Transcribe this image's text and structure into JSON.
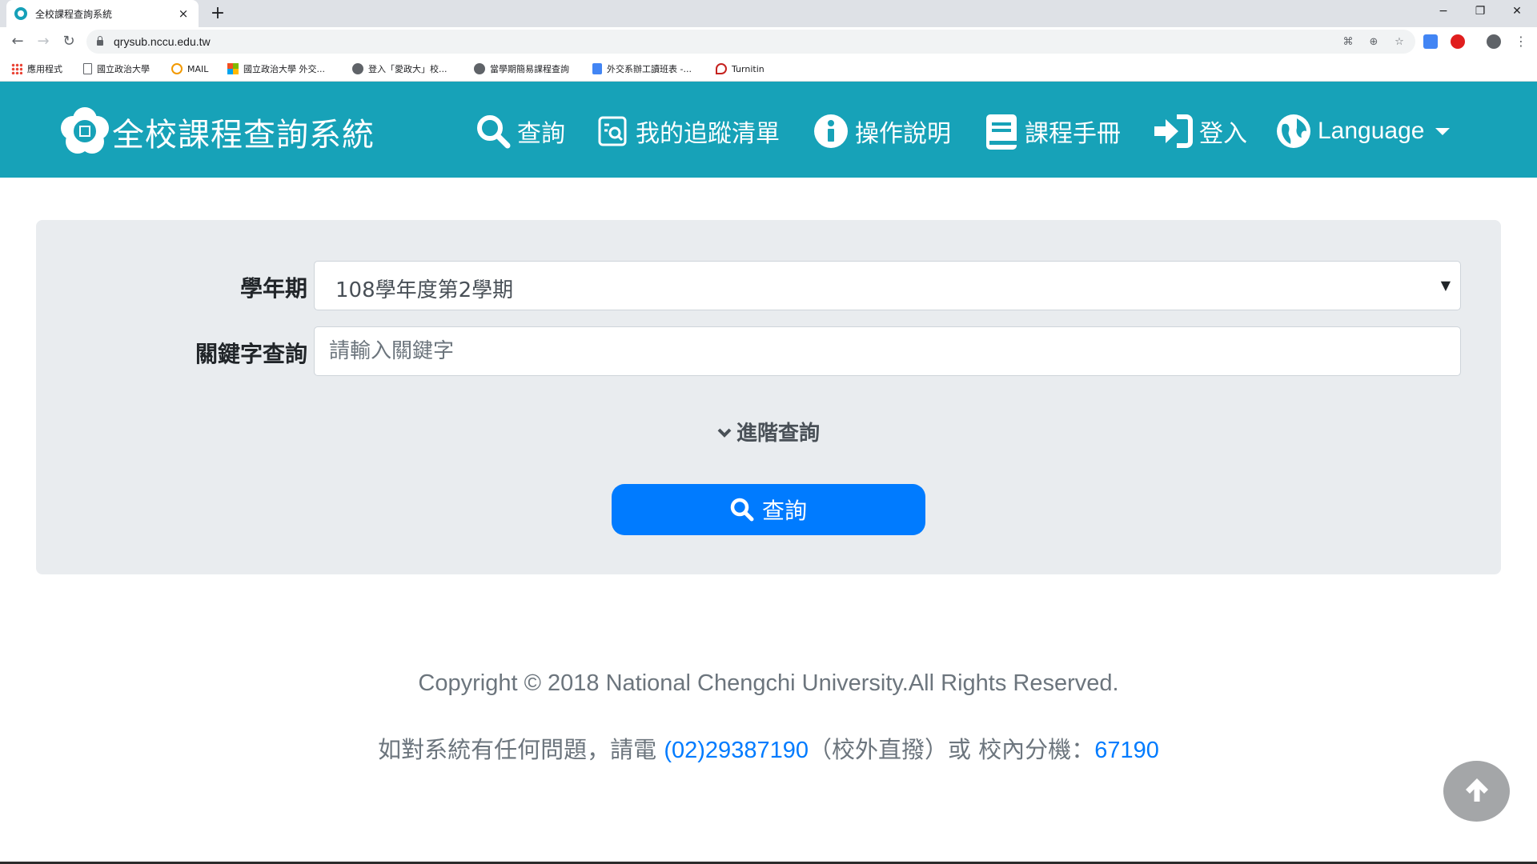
{
  "browser": {
    "tab_title": "全校課程查詢系統",
    "tab_close": "×",
    "new_tab": "+",
    "url": "qrysub.nccu.edu.tw",
    "window_controls": {
      "minimize": "−",
      "restore": "❐",
      "close": "✕"
    },
    "bookmarks": [
      {
        "label": "應用程式",
        "icon": "apps-grid-icon"
      },
      {
        "label": "國立政治大學",
        "icon": "page-icon"
      },
      {
        "label": "MAIL",
        "icon": "mail-icon"
      },
      {
        "label": "國立政治大學 外交...",
        "icon": "windows-icon"
      },
      {
        "label": "登入「愛政大」校...",
        "icon": "globe-icon"
      },
      {
        "label": "當學期簡易課程查詢",
        "icon": "globe-icon"
      },
      {
        "label": "外交系辦工讀班表 -...",
        "icon": "doc-icon"
      },
      {
        "label": "Turnitin",
        "icon": "turnitin-icon"
      }
    ]
  },
  "header": {
    "brand": "全校課程查詢系統",
    "nav": {
      "search": "查詢",
      "watchlist": "我的追蹤清單",
      "help": "操作說明",
      "handbook": "課程手冊",
      "login": "登入",
      "language": "Language"
    },
    "colors": {
      "bar": "#17a2b8",
      "text": "#ffffff"
    }
  },
  "form": {
    "semester_label": "學年期",
    "semester_value": "108學年度第2學期",
    "keyword_label": "關鍵字查詢",
    "keyword_placeholder": "請輸入關鍵字",
    "advanced_label": "進階查詢",
    "submit_label": "查詢",
    "colors": {
      "button": "#007bff",
      "card": "#e9ecef"
    }
  },
  "footer": {
    "copyright": "Copyright © 2018 National Chengchi University.All Rights Reserved.",
    "contact_prefix": "如對系統有任何問題，請電 ",
    "phone": "(02)29387190",
    "contact_middle": "（校外直撥）或 校內分機：",
    "extension": "67190"
  }
}
